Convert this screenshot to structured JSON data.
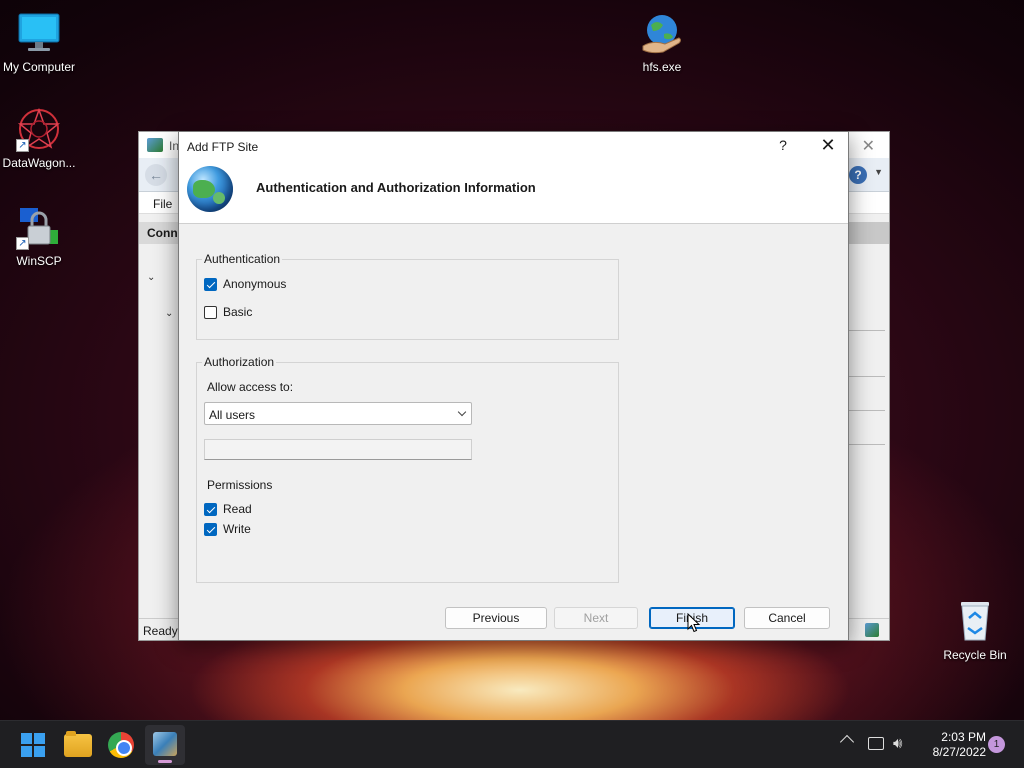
{
  "desktop": {
    "icons": [
      {
        "label": "My Computer"
      },
      {
        "label": "DataWagon..."
      },
      {
        "label": "WinSCP"
      },
      {
        "label": "hfs.exe"
      },
      {
        "label": "Recycle Bin"
      }
    ]
  },
  "bg_window": {
    "title": "In",
    "menu_file": "File",
    "connections_header": "Conn",
    "status": "Ready"
  },
  "dialog": {
    "title": "Add FTP Site",
    "help_glyph": "?",
    "close_glyph": "✕",
    "heading": "Authentication and Authorization Information",
    "authentication": {
      "group_label": "Authentication",
      "anonymous": {
        "label": "Anonymous",
        "checked": true
      },
      "basic": {
        "label": "Basic",
        "checked": false
      }
    },
    "authorization": {
      "group_label": "Authorization",
      "allow_access_label": "Allow access to:",
      "allow_access_value": "All users",
      "user_input_value": "",
      "permissions_label": "Permissions",
      "read": {
        "label": "Read",
        "checked": true
      },
      "write": {
        "label": "Write",
        "checked": true
      }
    },
    "buttons": {
      "previous": "Previous",
      "next": "Next",
      "finish": "Finish",
      "cancel": "Cancel"
    }
  },
  "taskbar": {
    "time": "2:03 PM",
    "date": "8/27/2022",
    "notification_count": "1"
  },
  "colors": {
    "accent": "#0067c0",
    "dialog_bg": "#f0f0f0",
    "taskbar_bg": "#1f1f22"
  }
}
